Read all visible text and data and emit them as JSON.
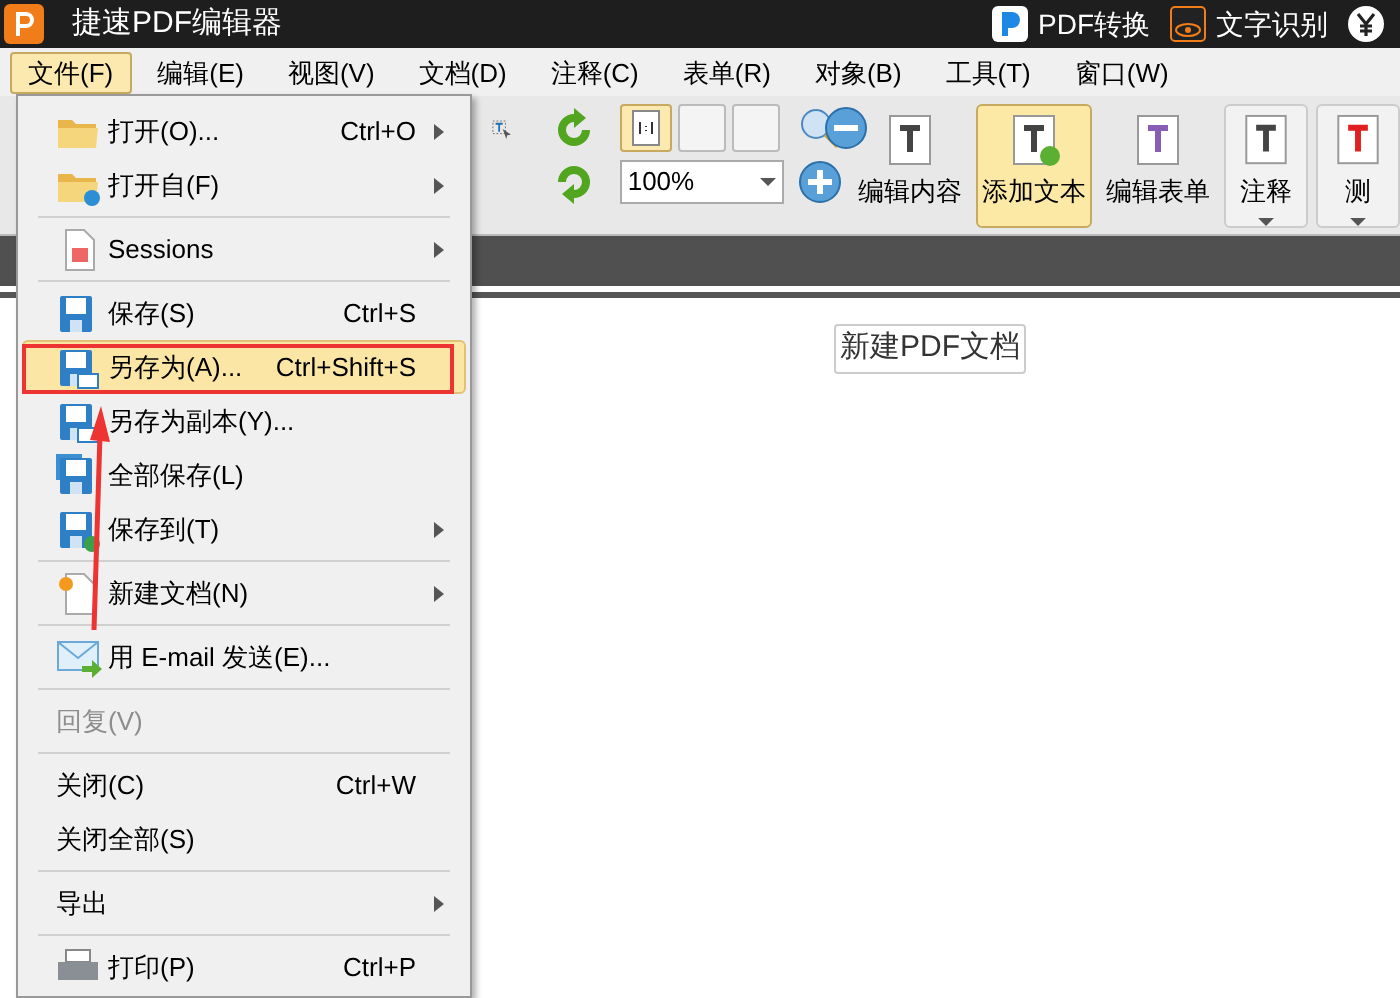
{
  "title_bar": {
    "app_title": "捷速PDF编辑器",
    "actions": [
      {
        "label": "PDF转换"
      },
      {
        "label": "文字识别"
      }
    ]
  },
  "menu_bar": [
    {
      "label": "文件(F)",
      "selected": true
    },
    {
      "label": "编辑(E)",
      "selected": false
    },
    {
      "label": "视图(V)",
      "selected": false
    },
    {
      "label": "文档(D)",
      "selected": false
    },
    {
      "label": "注释(C)",
      "selected": false
    },
    {
      "label": "表单(R)",
      "selected": false
    },
    {
      "label": "对象(B)",
      "selected": false
    },
    {
      "label": "工具(T)",
      "selected": false
    },
    {
      "label": "窗口(W)",
      "selected": false
    }
  ],
  "toolbar": {
    "zoom_value": "100%",
    "buttons": [
      {
        "label": "编辑内容",
        "selected": false,
        "dropdown": false
      },
      {
        "label": "添加文本",
        "selected": true,
        "dropdown": false
      },
      {
        "label": "编辑表单",
        "selected": false,
        "dropdown": false
      },
      {
        "label": "注释",
        "selected": false,
        "dropdown": true
      },
      {
        "label": "测",
        "selected": false,
        "dropdown": true
      }
    ]
  },
  "document": {
    "tab_label": "新建PDF文档"
  },
  "file_menu": [
    {
      "kind": "item",
      "label": "打开(O)...",
      "shortcut": "Ctrl+O",
      "submenu": true,
      "selected": false,
      "disabled": false
    },
    {
      "kind": "item",
      "label": "打开自(F)",
      "submenu": true,
      "selected": false,
      "disabled": false
    },
    {
      "kind": "separator"
    },
    {
      "kind": "item",
      "label": "Sessions",
      "submenu": true,
      "selected": false,
      "disabled": false
    },
    {
      "kind": "separator"
    },
    {
      "kind": "item",
      "label": "保存(S)",
      "shortcut": "Ctrl+S",
      "submenu": false,
      "selected": false,
      "disabled": false
    },
    {
      "kind": "item",
      "label": "另存为(A)...",
      "shortcut": "Ctrl+Shift+S",
      "submenu": false,
      "selected": true,
      "disabled": false
    },
    {
      "kind": "item",
      "label": "另存为副本(Y)...",
      "submenu": false,
      "selected": false,
      "disabled": false
    },
    {
      "kind": "item",
      "label": "全部保存(L)",
      "submenu": false,
      "selected": false,
      "disabled": false
    },
    {
      "kind": "item",
      "label": "保存到(T)",
      "submenu": true,
      "selected": false,
      "disabled": false
    },
    {
      "kind": "separator"
    },
    {
      "kind": "item",
      "label": "新建文档(N)",
      "submenu": true,
      "selected": false,
      "disabled": false
    },
    {
      "kind": "separator"
    },
    {
      "kind": "item",
      "label": "用 E-mail 发送(E)...",
      "submenu": false,
      "selected": false,
      "disabled": false
    },
    {
      "kind": "separator"
    },
    {
      "kind": "item",
      "label": "回复(V)",
      "submenu": false,
      "selected": false,
      "disabled": true
    },
    {
      "kind": "separator"
    },
    {
      "kind": "item",
      "label": "关闭(C)",
      "shortcut": "Ctrl+W",
      "submenu": false,
      "selected": false,
      "disabled": false
    },
    {
      "kind": "item",
      "label": "关闭全部(S)",
      "submenu": false,
      "selected": false,
      "disabled": false
    },
    {
      "kind": "separator"
    },
    {
      "kind": "item",
      "label": "导出",
      "submenu": true,
      "selected": false,
      "disabled": false
    },
    {
      "kind": "separator"
    },
    {
      "kind": "item",
      "label": "打印(P)",
      "shortcut": "Ctrl+P",
      "submenu": false,
      "selected": false,
      "disabled": false
    }
  ]
}
